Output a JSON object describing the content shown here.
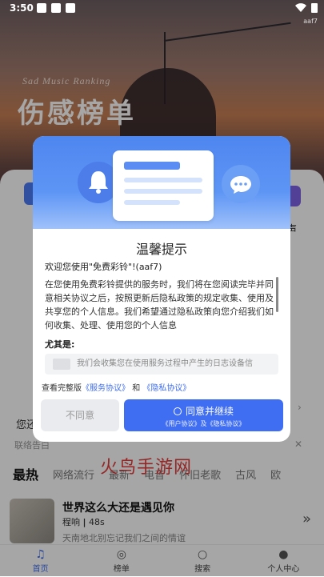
{
  "statusbar": {
    "time": "3:50",
    "tag": "aaf7"
  },
  "hero": {
    "subtitle": "Sad Music Ranking",
    "title": "伤感榜单"
  },
  "category": {
    "right_label": "声"
  },
  "notice": {
    "text": "您还",
    "subtext": "联络告白",
    "close": "✕",
    "right": "›"
  },
  "tabs": [
    "最热",
    "网络流行",
    "最新",
    "电音",
    "怀旧老歌",
    "古风",
    "欧"
  ],
  "watermark": "火鸟手游网",
  "song": {
    "title": "世界这么大还是遇见你",
    "artist": "程响",
    "duration": "48s",
    "lyric": "天南地北别忘记我们之间的情谊",
    "more": "»"
  },
  "bottomnav": [
    {
      "label": "首页",
      "icon": "music-note-icon"
    },
    {
      "label": "榜单",
      "icon": "medal-icon"
    },
    {
      "label": "搜索",
      "icon": "search-icon"
    },
    {
      "label": "个人中心",
      "icon": "user-icon"
    }
  ],
  "dialog": {
    "title": "温馨提示",
    "greeting": "欢迎您使用\"免费彩铃\"!(aaf7)",
    "body": "在您使用免费彩铃提供的服务时，我们将在您阅读完毕并同意相关协议之后，按照更新后隐私政策的规定收集、使用及共享您的个人信息。我们希望通过隐私政策向您介绍我们如何收集、处理、使用您的个人信息",
    "subheading": "尤其是:",
    "box_text": "我们会收集您在使用服务过程中产生的日志设备信",
    "links_prefix": "查看完整版",
    "service_link": "《服务协议》",
    "and": "和",
    "privacy_link": "《隐私协议》",
    "reject": "不同意",
    "accept": "同意并继续",
    "accept_sub": "《用户协议》及《隐私协议》"
  },
  "colors": {
    "accent": "#3f6ef2",
    "dialog_header": "#5d95f5"
  }
}
